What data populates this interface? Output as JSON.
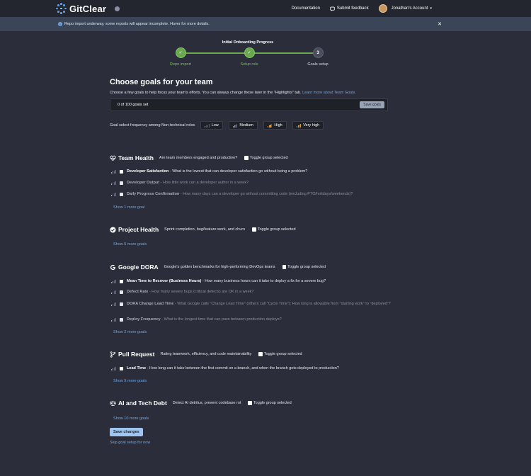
{
  "header": {
    "logo_text": "GitClear",
    "documentation": "Documentation",
    "submit_feedback": "Submit feedback",
    "account": "Jonathan's Account"
  },
  "banner": {
    "text": "Repo import underway, some reports will appear incomplete. Hover for more details."
  },
  "progress": {
    "title": "Initial Onboarding Progress",
    "steps": [
      {
        "label": "Repo import",
        "status": "done",
        "symbol": "✓"
      },
      {
        "label": "Setup role",
        "status": "done",
        "symbol": "✓"
      },
      {
        "label": "Goals setup",
        "status": "todo",
        "symbol": "3"
      }
    ]
  },
  "main": {
    "title": "Choose goals for your team",
    "intro": "Choose a few goals to help focus your team's efforts. You can always change these later in the \"Highlights\" tab.",
    "intro_link": "Learn more about Team Goals.",
    "goal_count": "0 of 100 goals set",
    "save_goals": "Save goals",
    "freq_label": "Goal select frequency among Non-technical roles",
    "freq_levels": [
      {
        "label": "Low",
        "level": 1
      },
      {
        "label": "Medium",
        "level": 2
      },
      {
        "label": "High",
        "level": 3
      },
      {
        "label": "Very high",
        "level": 4
      }
    ]
  },
  "groups": [
    {
      "title": "Team Health",
      "icon": "heart-pulse-icon",
      "desc": "Are team members engaged and productive?",
      "toggle": "Toggle group selected",
      "goals": [
        {
          "name": "Developer Satisfaction",
          "desc": " - What is the lowest that can developer satisfaction go without being a problem?",
          "active": true,
          "level": 2
        },
        {
          "name": "Developer Output",
          "desc": " - How little work can a developer author in a week?",
          "active": false,
          "level": 1
        },
        {
          "name": "Daily Progress Confirmation",
          "desc": " - How many days can a developer go without committing code (excluding PTO/holidays/weekends)?",
          "active": false,
          "level": 1
        }
      ],
      "show_more": "Show 1 more goal"
    },
    {
      "title": "Project Health",
      "icon": "check-circle-icon",
      "desc": "Sprint completion, bug/feature work, and churn",
      "toggle": "Toggle group selected",
      "goals": [],
      "show_more": "Show 5 more goals"
    },
    {
      "title": "Google DORA",
      "icon": "google-icon",
      "desc": "Google's golden benchmarks for high-performing DevOps teams",
      "toggle": "Toggle group selected",
      "goals": [
        {
          "name": "Mean Time to Recover (Business Hours)",
          "desc": " - How many business hours can it take to deploy a fix for a severe bug?",
          "active": true,
          "level": 2
        },
        {
          "name": "Defect Rate",
          "desc": " - How many severe bugs (critical defects) are OK in a week?",
          "active": false,
          "level": 1
        },
        {
          "name": "DORA Change Lead Time",
          "desc": " - What Google calls \"Change Lead Time\" (others call \"Cycle Time\"): How long is allowable from \"starting work\" to \"deployed\"?",
          "active": false,
          "level": 1
        },
        {
          "name": "Deploy Frequency",
          "desc": " - What is the longest time that can pass between production deploys?",
          "active": false,
          "level": 1
        }
      ],
      "show_more": "Show 2 more goals"
    },
    {
      "title": "Pull Request",
      "icon": "git-branch-icon",
      "desc": "Rating teamwork, efficiency, and code maintainability",
      "toggle": "Toggle group selected",
      "goals": [
        {
          "name": "Lead Time",
          "desc": " - How long can it take between the first commit on a branch, and when the branch gets deployed to production?",
          "active": true,
          "level": 2
        }
      ],
      "show_more": "Show 9 more goals"
    },
    {
      "title": "AI and Tech Debt",
      "icon": "balance-scale-icon",
      "desc": "Detect AI detritus, prevent codebase rot",
      "toggle": "Toggle group selected",
      "goals": [],
      "show_more": "Show 10 more goals"
    }
  ],
  "footer": {
    "save_changes": "Save changes",
    "skip": "Skip goal setup for now"
  },
  "colors": {
    "background": "#2b2e3a",
    "topbar": "#23262f",
    "banner": "#3a4658",
    "link": "#6fa6e6",
    "done_green": "#6aa84f",
    "bar_orange": "#d49b42"
  }
}
